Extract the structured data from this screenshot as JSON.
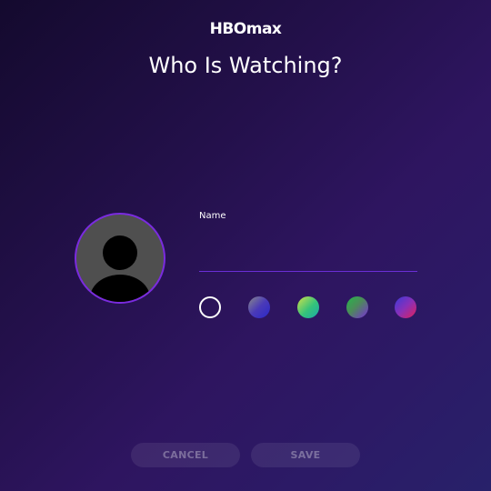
{
  "header": {
    "logo": "HBOmax",
    "title": "Who Is Watching?"
  },
  "profile": {
    "avatar_icon": "person-silhouette-icon",
    "name_label": "Name",
    "name_value": "",
    "name_placeholder": ""
  },
  "colors": {
    "background_start": "#140a2e",
    "background_end": "#28216a",
    "accent": "#7a2bdf",
    "avatar_bg": "#4f4f4f"
  },
  "swatches": [
    {
      "name": "outline",
      "selected": true
    },
    {
      "name": "gray-blue"
    },
    {
      "name": "yellow-green-teal"
    },
    {
      "name": "green-purple"
    },
    {
      "name": "blue-magenta-red"
    }
  ],
  "actions": {
    "cancel_label": "CANCEL",
    "save_label": "SAVE"
  }
}
